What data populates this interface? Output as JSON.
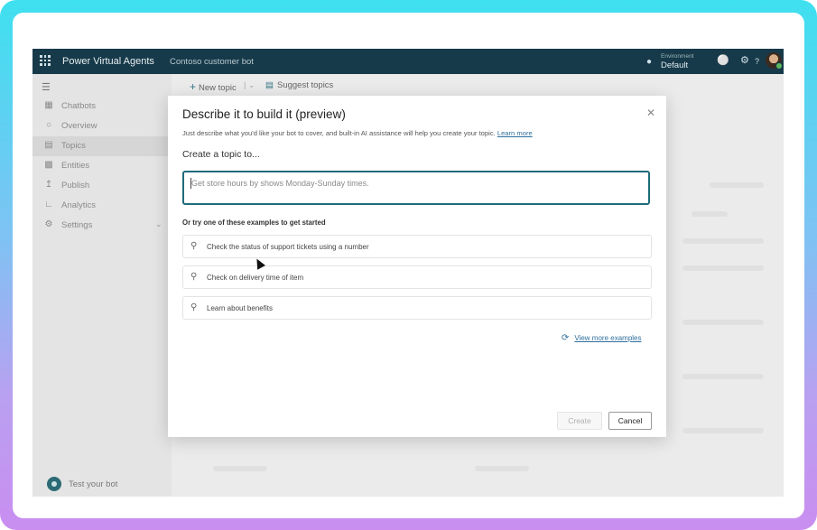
{
  "topbar": {
    "app_name": "Power Virtual Agents",
    "bot_name": "Contoso customer bot",
    "env_label": "Environment",
    "env_value": "Default",
    "icons": [
      "waffle-icon",
      "bell-icon",
      "gear-icon",
      "help-icon"
    ],
    "help_glyph": "?"
  },
  "sidebar": {
    "items": [
      {
        "icon": "chatbots-icon",
        "label": "Chatbots"
      },
      {
        "icon": "overview-icon",
        "label": "Overview"
      },
      {
        "icon": "topics-icon",
        "label": "Topics",
        "active": true
      },
      {
        "icon": "entities-icon",
        "label": "Entities"
      },
      {
        "icon": "publish-icon",
        "label": "Publish"
      },
      {
        "icon": "analytics-icon",
        "label": "Analytics"
      },
      {
        "icon": "settings-icon",
        "label": "Settings"
      }
    ],
    "test_bot": "Test your bot"
  },
  "cmdbar": {
    "new_topic": "New topic",
    "suggest_topics": "Suggest topics"
  },
  "dialog": {
    "title": "Describe it to build it (preview)",
    "description": "Just describe what you'd like your bot to cover, and built-in AI assistance will help you create your topic.",
    "learn_more": "Learn more",
    "create_heading": "Create a topic to...",
    "input_placeholder": "Get store hours by shows Monday-Sunday times.",
    "examples_heading": "Or try one of these examples to get started",
    "examples": [
      "Check the status of support tickets using a number",
      "Check on delivery time of item",
      "Learn about benefits"
    ],
    "view_more": "View more examples",
    "create_label": "Create",
    "cancel_label": "Cancel"
  },
  "colors": {
    "accent": "#1f6b7a",
    "topbar": "#173a4a",
    "link": "#2f6f9e",
    "frame_gradient": [
      "#3ee0f0",
      "#c98ef0"
    ]
  }
}
